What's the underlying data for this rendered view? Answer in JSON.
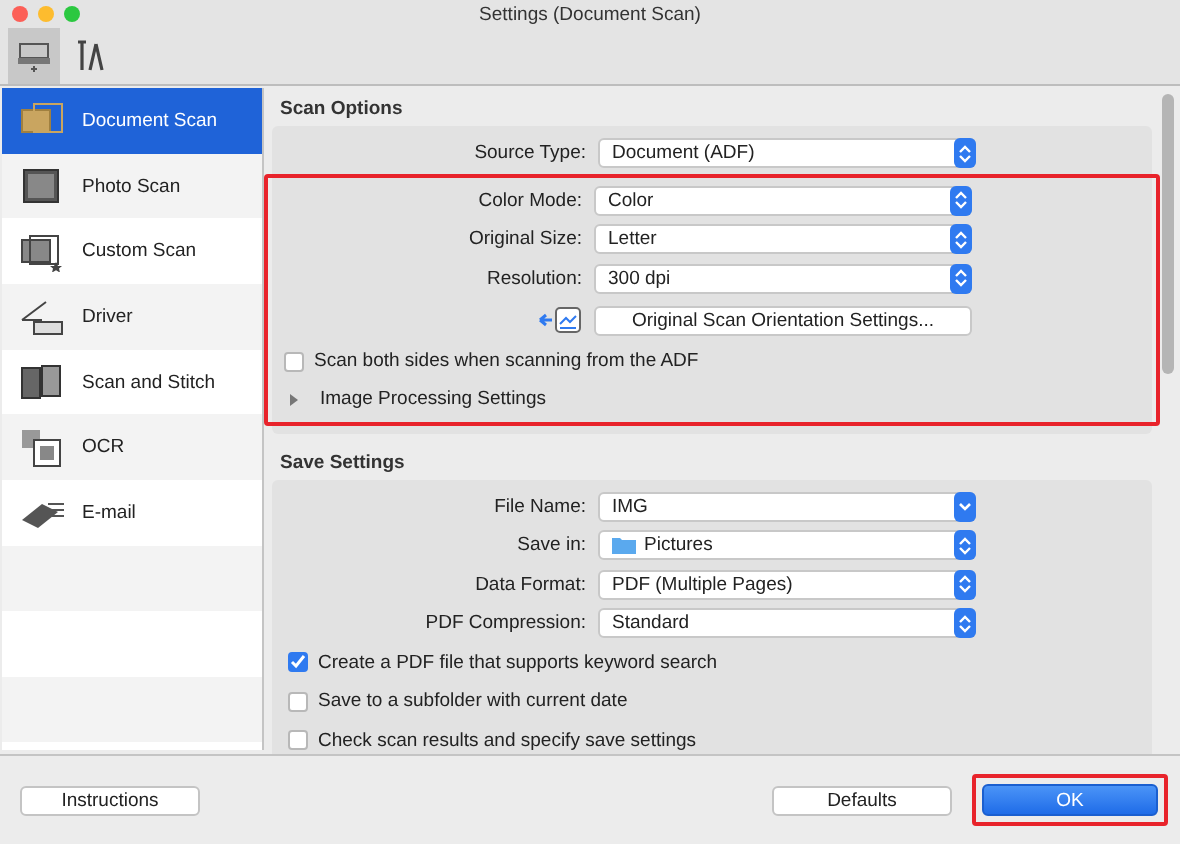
{
  "window": {
    "title": "Settings (Document Scan)"
  },
  "toolbar_tabs": [
    {
      "kind": "scanner",
      "selected": true
    },
    {
      "kind": "tools",
      "selected": false
    }
  ],
  "sidebar": {
    "items": [
      {
        "kind": "document",
        "label": "Document Scan",
        "selected": true
      },
      {
        "kind": "photo",
        "label": "Photo Scan",
        "selected": false
      },
      {
        "kind": "custom",
        "label": "Custom Scan",
        "selected": false
      },
      {
        "kind": "driver",
        "label": "Driver",
        "selected": false
      },
      {
        "kind": "stitch",
        "label": "Scan and Stitch",
        "selected": false
      },
      {
        "kind": "ocr",
        "label": "OCR",
        "selected": false
      },
      {
        "kind": "email",
        "label": "E-mail",
        "selected": false
      }
    ]
  },
  "scan_options": {
    "title": "Scan Options",
    "source": {
      "label": "Source Type:",
      "value": "Document (ADF)"
    },
    "highlighted": true,
    "fields": [
      {
        "label": "Color Mode:",
        "value": "Color"
      },
      {
        "label": "Original Size:",
        "value": "Letter"
      },
      {
        "label": "Resolution:",
        "value": "300 dpi"
      }
    ],
    "orientation_button": "Original Scan Orientation Settings...",
    "checks": [
      {
        "label": "Scan both sides when scanning from the ADF",
        "checked": false
      }
    ],
    "image_processing": {
      "label": "Image Processing Settings",
      "expanded": false
    }
  },
  "save_settings": {
    "title": "Save Settings",
    "fields": [
      {
        "kind": "combo",
        "label": "File Name:",
        "value": "IMG"
      },
      {
        "kind": "folder",
        "label": "Save in:",
        "value": "Pictures"
      },
      {
        "kind": "select",
        "label": "Data Format:",
        "value": "PDF (Multiple Pages)"
      },
      {
        "kind": "select",
        "label": "PDF Compression:",
        "value": "Standard"
      }
    ],
    "checks": [
      {
        "label": "Create a PDF file that supports keyword search",
        "checked": true
      },
      {
        "label": "Save to a subfolder with current date",
        "checked": false
      },
      {
        "label": "Check scan results and specify save settings",
        "checked": false
      }
    ]
  },
  "buttons": {
    "instructions": "Instructions",
    "defaults": "Defaults",
    "ok": {
      "label": "OK",
      "highlighted": true
    }
  }
}
